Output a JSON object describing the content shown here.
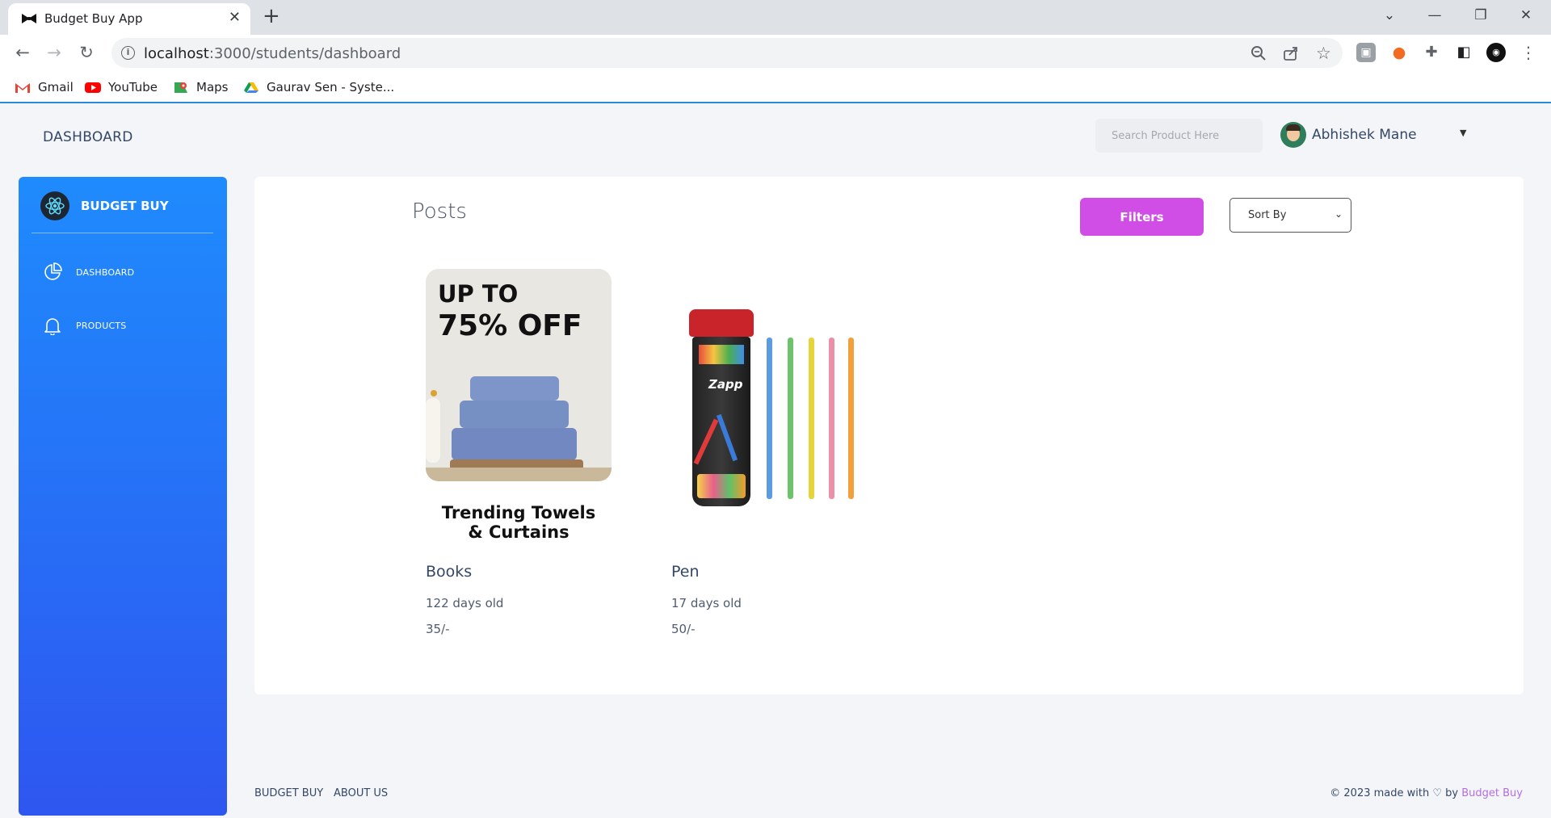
{
  "browser": {
    "tab_title": "Budget Buy App",
    "url_host": "localhost",
    "url_path": ":3000/students/dashboard",
    "bookmarks": [
      {
        "label": "Gmail",
        "color": "#ea4335"
      },
      {
        "label": "YouTube",
        "color": "#ff0000"
      },
      {
        "label": "Maps",
        "color": "#34a853"
      },
      {
        "label": "Gaurav Sen - Syste...",
        "color": "#fbbc04"
      }
    ]
  },
  "header": {
    "page_title": "DASHBOARD",
    "search_placeholder": "Search Product Here",
    "user_name": "Abhishek Mane"
  },
  "sidebar": {
    "brand": "BUDGET BUY",
    "items": [
      {
        "label": "DASHBOARD",
        "icon": "pie-chart-icon"
      },
      {
        "label": "PRODUCTS",
        "icon": "bell-icon"
      }
    ]
  },
  "main": {
    "title": "Posts",
    "filters_label": "Filters",
    "sort_label": "Sort By",
    "products": [
      {
        "name": "Books",
        "age": "122 days old",
        "price": "35/-",
        "image": {
          "line1": "UP TO",
          "line2": "75% OFF",
          "caption_1": "Trending Towels",
          "caption_2": "& Curtains"
        }
      },
      {
        "name": "Pen",
        "age": "17 days old",
        "price": "50/-",
        "image": {
          "jar_label": "Zapp"
        }
      }
    ]
  },
  "footer": {
    "links": [
      "BUDGET BUY",
      "ABOUT US"
    ],
    "credit_prefix": "© 2023 made with",
    "credit_by": "by",
    "credit_brand": "Budget Buy"
  },
  "colors": {
    "sidebar_top": "#1f8bfd",
    "sidebar_bottom": "#2e56f0",
    "filters_button": "#d14ee6",
    "brand_link": "#b46ee0"
  }
}
